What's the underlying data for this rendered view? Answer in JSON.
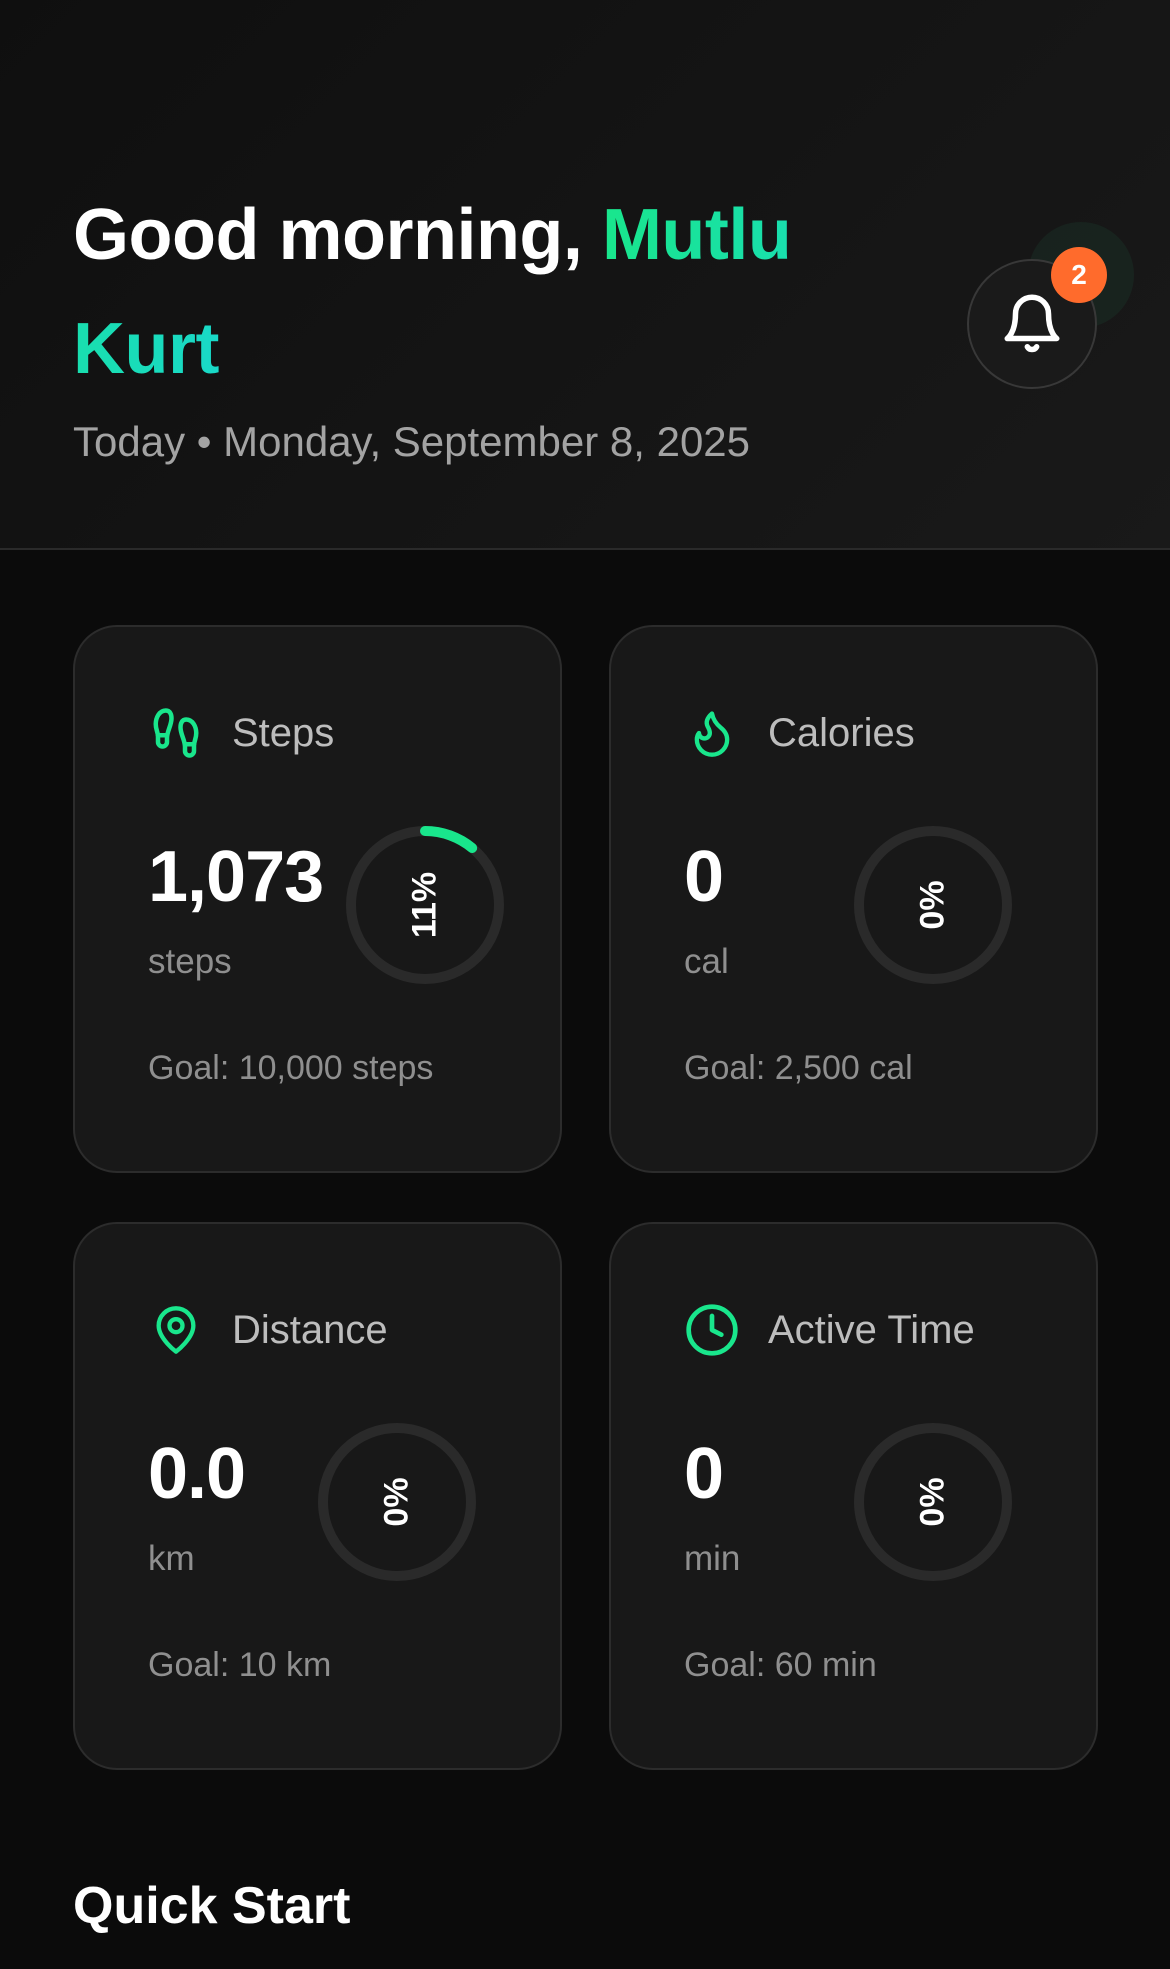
{
  "header": {
    "greeting": "Good morning,",
    "user_name": "Mutlu Kurt",
    "date_prefix": "Today",
    "separator": "•",
    "date": "Monday, September 8, 2025",
    "notifications": {
      "icon": "bell-icon",
      "count": "2"
    }
  },
  "colors": {
    "accent": "#19e68c",
    "accent_alt": "#19d9c8",
    "badge": "#ff6b2c",
    "ring_track": "#2a2a2a"
  },
  "stats": [
    {
      "key": "steps",
      "icon": "footprints-icon",
      "label": "Steps",
      "value": "1,073",
      "unit": "steps",
      "percent_label": "11%",
      "progress": 0.11,
      "goal": "Goal: 10,000 steps"
    },
    {
      "key": "calories",
      "icon": "flame-icon",
      "label": "Calories",
      "value": "0",
      "unit": "cal",
      "percent_label": "0%",
      "progress": 0,
      "goal": "Goal: 2,500 cal"
    },
    {
      "key": "distance",
      "icon": "map-pin-icon",
      "label": "Distance",
      "value": "0.0",
      "unit": "km",
      "percent_label": "0%",
      "progress": 0,
      "goal": "Goal: 10 km"
    },
    {
      "key": "active-time",
      "icon": "clock-icon",
      "label": "Active Time",
      "value": "0",
      "unit": "min",
      "percent_label": "0%",
      "progress": 0,
      "goal": "Goal: 60 min"
    }
  ],
  "quick_start": {
    "title": "Quick Start"
  }
}
